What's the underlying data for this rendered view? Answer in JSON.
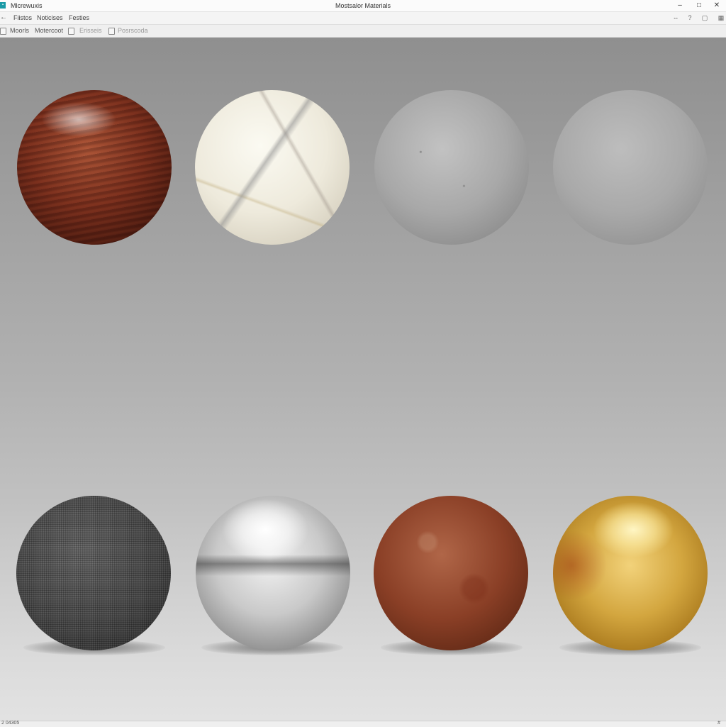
{
  "titlebar": {
    "app_name": "Mlcrewuxis",
    "title": "Mostsalor Materials",
    "app_icon": "app-logo-icon",
    "minimize_icon": "–",
    "maximize_icon": "□",
    "close_icon": "✕"
  },
  "menubar": {
    "back_icon": "←",
    "items": [
      "Fiistos",
      "Noticises",
      "Festies"
    ],
    "right_icons": [
      "⇔",
      "?",
      "▢",
      "▦"
    ]
  },
  "toolbar": {
    "items": [
      {
        "label": "Moorls",
        "state": "normal"
      },
      {
        "label": "Motercoot",
        "state": "active"
      },
      {
        "label": "Erisseis",
        "state": "dim"
      },
      {
        "label": "Posrscoda",
        "state": "dim"
      }
    ]
  },
  "materials": [
    {
      "name": "wood",
      "row": 1
    },
    {
      "name": "marble",
      "row": 1
    },
    {
      "name": "concrete",
      "row": 1
    },
    {
      "name": "plaster",
      "row": 1
    },
    {
      "name": "fabric",
      "row": 2
    },
    {
      "name": "chrome",
      "row": 2
    },
    {
      "name": "rusted-metal",
      "row": 2
    },
    {
      "name": "gold",
      "row": 2
    }
  ],
  "statusbar": {
    "text": "2 04305",
    "icon": "#"
  }
}
